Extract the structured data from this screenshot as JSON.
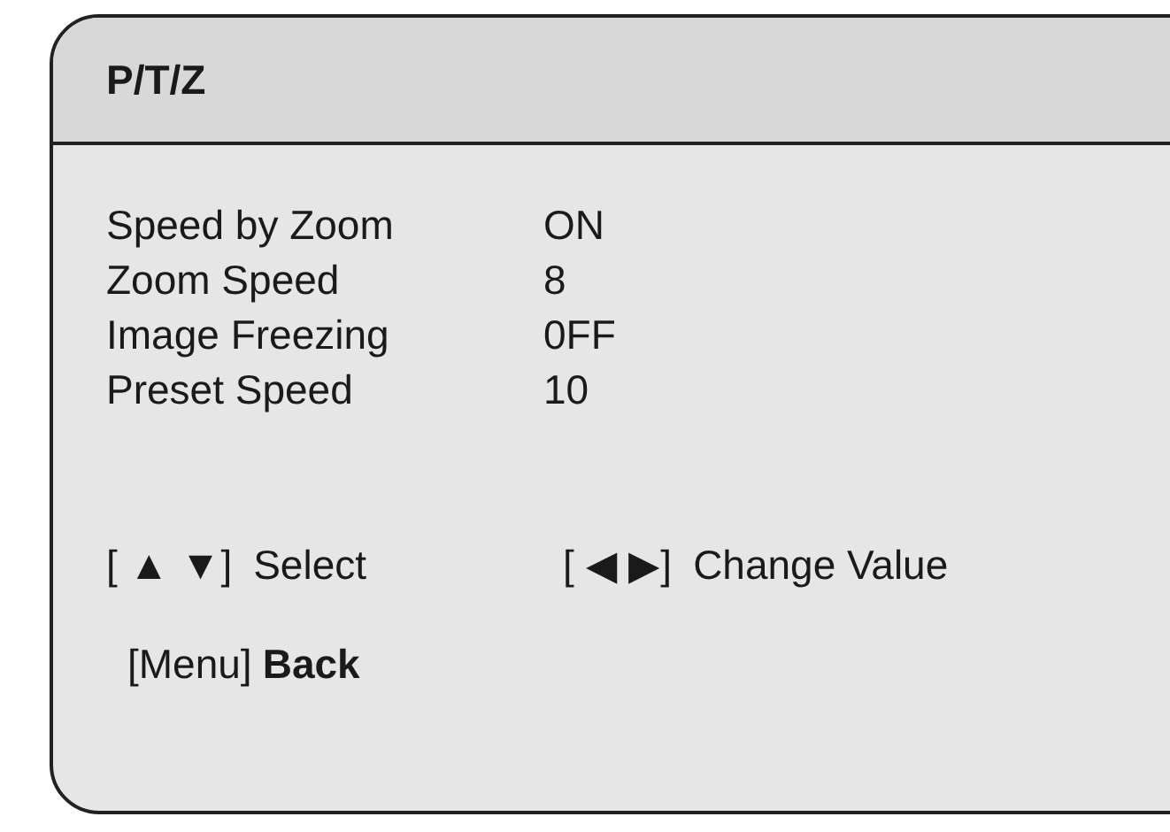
{
  "title": "P/T/Z",
  "items": [
    {
      "label": "Speed by Zoom",
      "value": "ON"
    },
    {
      "label": "Zoom Speed",
      "value": "8"
    },
    {
      "label": "Image Freezing",
      "value": "0FF"
    },
    {
      "label": "Preset Speed",
      "value": "10"
    }
  ],
  "hints": [
    {
      "keys": "[ ▲  ▼]",
      "action": "Select"
    },
    {
      "keys": "[ ◀  ▶]",
      "action": "Change Value"
    }
  ],
  "footer": {
    "key": "[Menu]",
    "action": "Back"
  }
}
